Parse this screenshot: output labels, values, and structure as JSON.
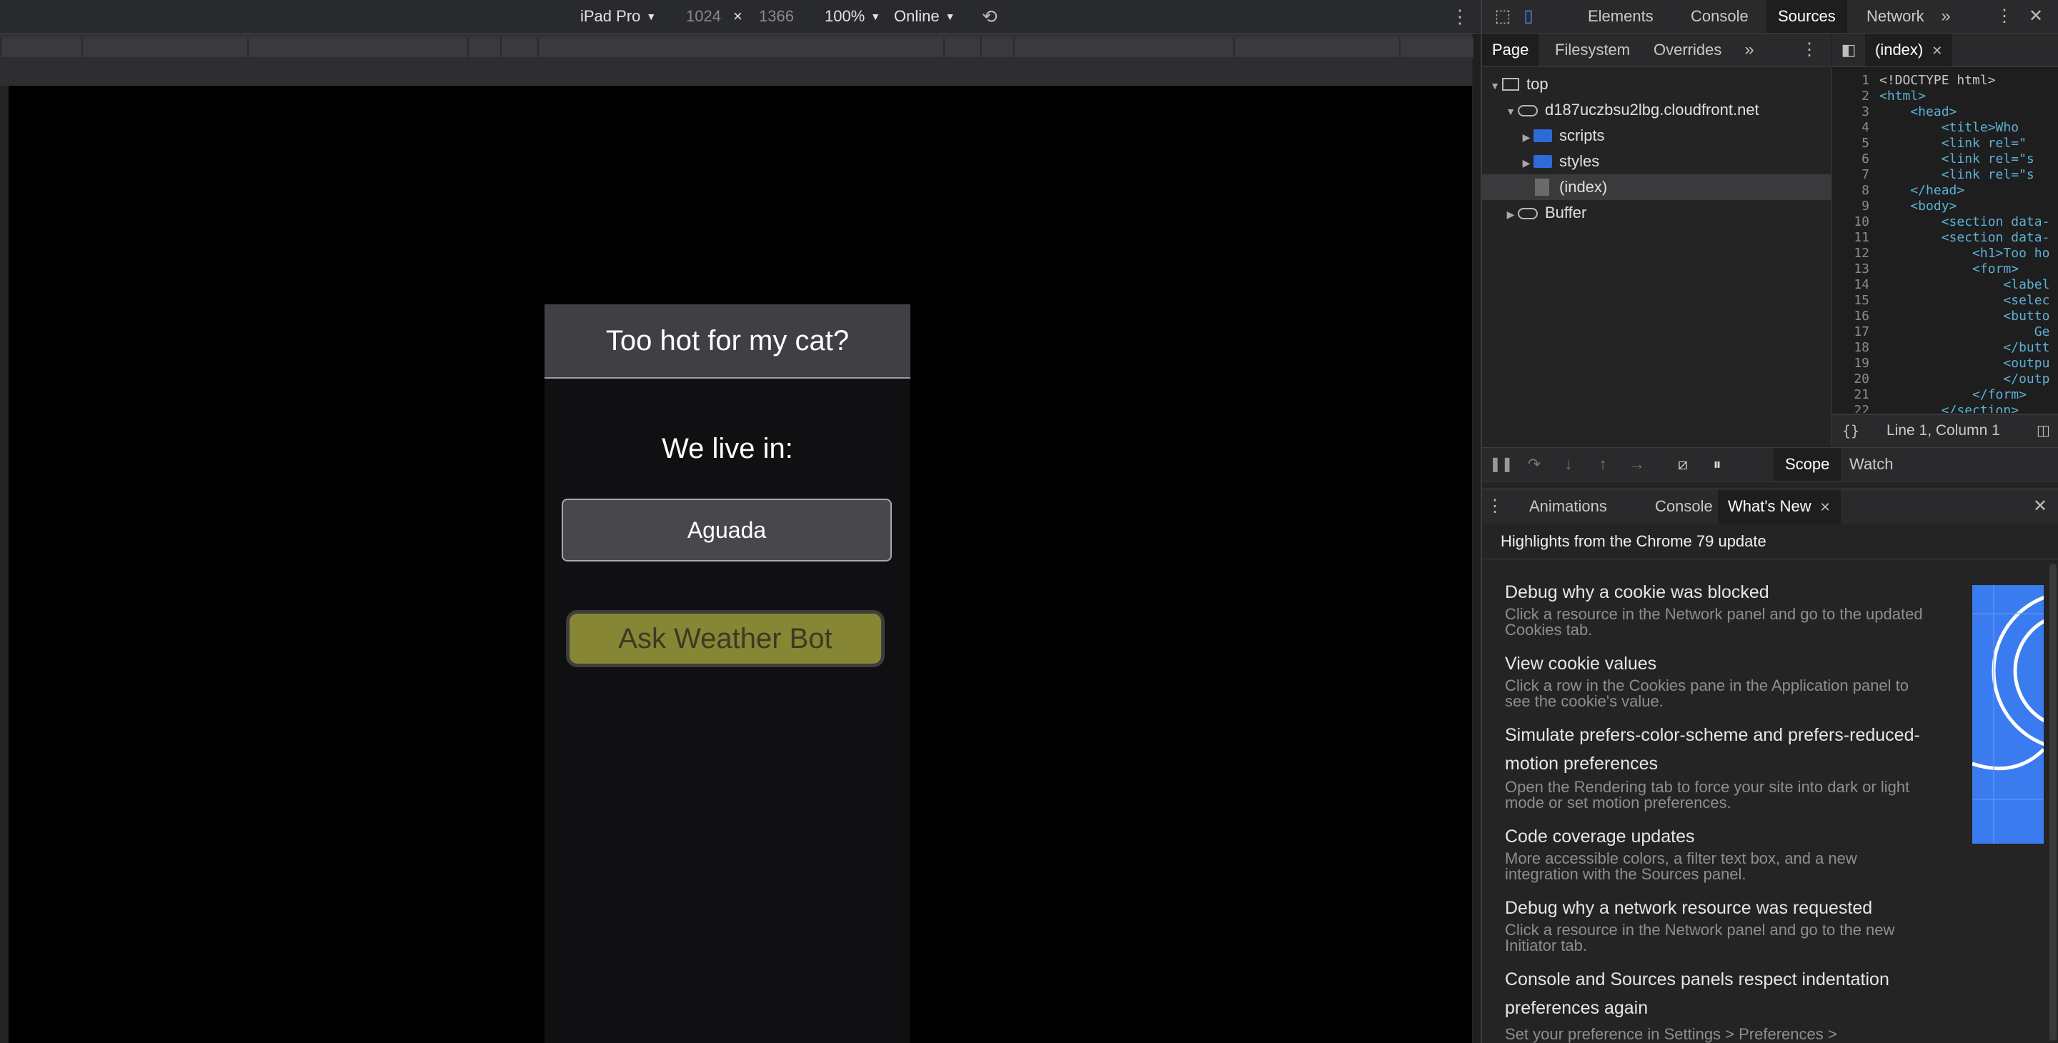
{
  "device_toolbar": {
    "device": "iPad Pro",
    "width": "1024",
    "times": "×",
    "height": "1366",
    "zoom": "100%",
    "network": "Online"
  },
  "app": {
    "title": "Too hot for my cat?",
    "live_label": "We live in:",
    "location_value": "Aguada",
    "ask_button": "Ask Weather Bot"
  },
  "devtools": {
    "tabs": [
      "Elements",
      "Console",
      "Sources",
      "Network"
    ],
    "active_tab": "Sources",
    "sources_subtabs": [
      "Page",
      "Filesystem",
      "Overrides"
    ],
    "tree": {
      "top": "top",
      "domain": "d187uczbsu2lbg.cloudfront.net",
      "scripts": "scripts",
      "styles": "styles",
      "index": "(index)",
      "buffer": "Buffer"
    },
    "editor_tab": "(index)",
    "code_lines": [
      "<!DOCTYPE html>",
      "<html>",
      "    <head>",
      "        <title>Who ",
      "        <link rel=\"",
      "        <link rel=\"s",
      "        <link rel=\"s",
      "    </head>",
      "    <body>",
      "        <section data-",
      "        <section data-",
      "            <h1>Too ho",
      "            <form>",
      "                <label",
      "                <selec",
      "                <butto",
      "                    Ge",
      "                </butt",
      "                <outpu",
      "                </outp",
      "            </form>",
      "        </section>"
    ],
    "line_numbers": [
      "1",
      "2",
      "3",
      "4",
      "5",
      "6",
      "7",
      "8",
      "9",
      "10",
      "11",
      "12",
      "13",
      "14",
      "15",
      "16",
      "17",
      "18",
      "19",
      "20",
      "21",
      "22"
    ],
    "cursor_status": "Line 1, Column 1",
    "debug_tabs": [
      "Scope",
      "Watch"
    ],
    "drawer_tabs": [
      "Animations",
      "Console",
      "What's New"
    ],
    "whats_new": {
      "header": "Highlights from the Chrome 79 update",
      "items": [
        {
          "title": "Debug why a cookie was blocked",
          "desc": "Click a resource in the Network panel and go to the updated Cookies tab."
        },
        {
          "title": "View cookie values",
          "desc": "Click a row in the Cookies pane in the Application panel to see the cookie's value."
        },
        {
          "title": "Simulate prefers-color-scheme and prefers-reduced-motion preferences",
          "desc": "Open the Rendering tab to force your site into dark or light mode or set motion preferences."
        },
        {
          "title": "Code coverage updates",
          "desc": "More accessible colors, a filter text box, and a new integration with the Sources panel."
        },
        {
          "title": "Debug why a network resource was requested",
          "desc": "Click a resource in the Network panel and go to the new Initiator tab."
        },
        {
          "title": "Console and Sources panels respect indentation preferences again",
          "desc": "Set your preference in Settings > Preferences >"
        }
      ]
    }
  },
  "colors": {
    "accent_blue": "#3b7bf0",
    "button_olive": "#868635",
    "viewport_bg": "#000000"
  }
}
